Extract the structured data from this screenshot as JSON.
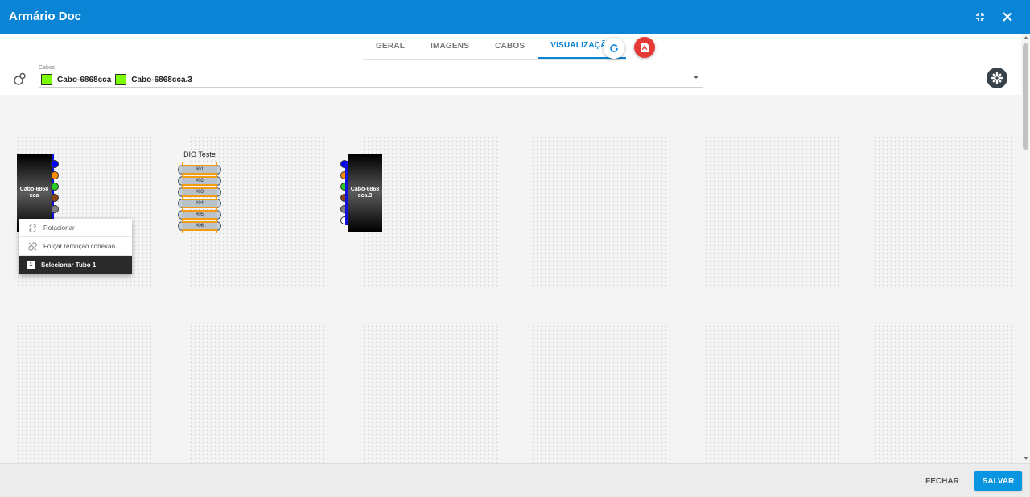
{
  "window": {
    "title": "Armário Doc"
  },
  "tabs": [
    {
      "label": "GERAL"
    },
    {
      "label": "IMAGENS"
    },
    {
      "label": "CABOS"
    },
    {
      "label": "VISUALIZAÇÃO",
      "active": true
    }
  ],
  "toolbar": {
    "cabos_label": "Cabos",
    "selected_cables": [
      {
        "label": "Cabo-6868cca",
        "color": "#7cfc00"
      },
      {
        "label": "Cabo-6868cca.3",
        "color": "#7cfc00"
      }
    ]
  },
  "diagram": {
    "cable_left": {
      "label_line1": "Cabo-6868",
      "label_line2": "cca",
      "fibers": [
        "#0000ff",
        "#ff8c00",
        "#22cc22",
        "#8b4513",
        "#808080",
        "#ffffff"
      ]
    },
    "cable_right": {
      "label_line1": "Cabo-6868",
      "label_line2": "cca.3",
      "fibers": [
        "#0000ff",
        "#ff8c00",
        "#22cc22",
        "#8b4513",
        "#808080",
        "#ffffff"
      ]
    },
    "dio": {
      "title": "DIO Teste",
      "ports": [
        "#01",
        "#02",
        "#03",
        "#04",
        "#05",
        "#06"
      ]
    }
  },
  "context_menu": {
    "items": [
      {
        "label": "Rotacionar",
        "icon": "rotate-icon"
      },
      {
        "label": "Forçar remoção conexão",
        "icon": "unlink-icon"
      },
      {
        "label": "Selecionar Tubo 1",
        "icon": "tube-number-icon",
        "badge": "1",
        "highlighted": true
      }
    ]
  },
  "footer": {
    "close_label": "FECHAR",
    "save_label": "SALVAR"
  },
  "colors": {
    "header": "#0a85d6",
    "accent": "#0a85d6",
    "pdf": "#e53935",
    "save": "#0a95e0"
  }
}
